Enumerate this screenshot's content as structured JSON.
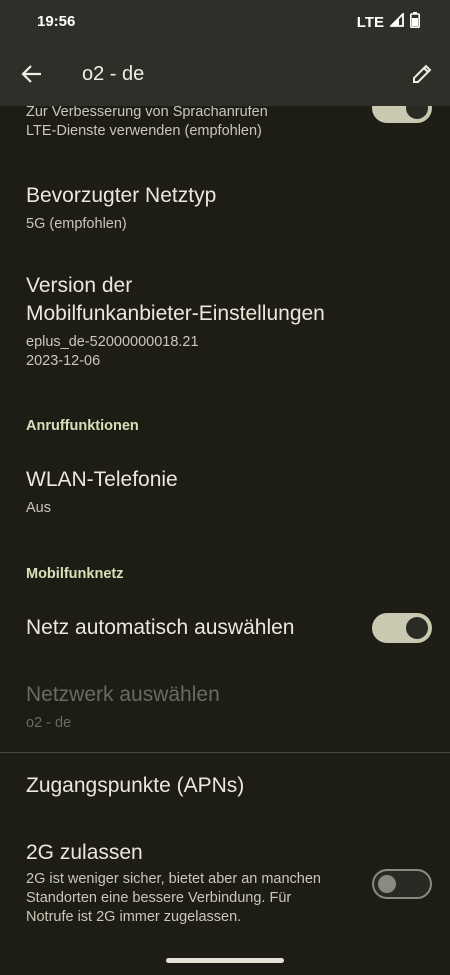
{
  "status_bar": {
    "time": "19:56",
    "network": "LTE",
    "icons": [
      "signal-icon",
      "battery-icon"
    ]
  },
  "app_bar": {
    "title": "o2 - de",
    "back_icon": "arrow-back-icon",
    "edit_icon": "pencil-icon"
  },
  "items": {
    "volte": {
      "summary_line1": "Zur Verbesserung von Sprachanrufen",
      "summary_line2": "LTE-Dienste verwenden (empfohlen)",
      "toggle_state": "on"
    },
    "preferred_network": {
      "title": "Bevorzugter Netztyp",
      "summary": "5G (empfohlen)"
    },
    "carrier_settings": {
      "title_line1": "Version der",
      "title_line2": "Mobilfunkanbieter-Einstellungen",
      "summary_line1": "eplus_de-52000000018.21",
      "summary_line2": "2023-12-06"
    },
    "wifi_calling": {
      "title": "WLAN-Telefonie",
      "summary": "Aus"
    },
    "auto_select": {
      "title": "Netz automatisch auswählen",
      "toggle_state": "on"
    },
    "select_network": {
      "title": "Netzwerk auswählen",
      "summary": "o2 - de"
    },
    "apn": {
      "title": "Zugangspunkte (APNs)"
    },
    "allow_2g": {
      "title": "2G zulassen",
      "summary_line1": "2G ist weniger sicher, bietet aber an manchen",
      "summary_line2": "Standorten eine bessere Verbindung. Für",
      "summary_line3": "Notrufe ist 2G immer zugelassen.",
      "toggle_state": "off"
    }
  },
  "sections": {
    "calling": "Anruffunktionen",
    "mobile_network": "Mobilfunknetz"
  },
  "colors": {
    "background": "#1d1d16",
    "app_bar": "#2f2f2a",
    "section_header": "#d8e0b8",
    "toggle_on_track": "#c8c9b0"
  }
}
